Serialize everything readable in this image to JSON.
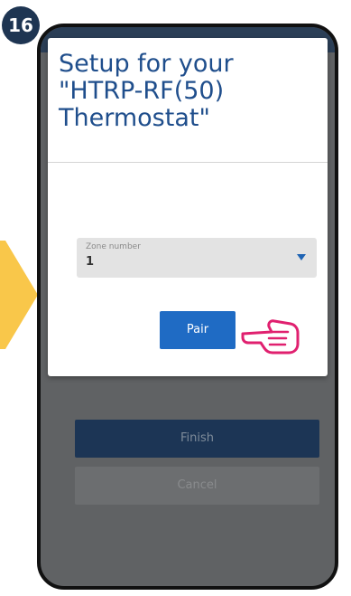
{
  "step": {
    "number": "16"
  },
  "dialog": {
    "title": "Setup for your\n\"HTRP-RF(50)\nThermostat\"",
    "zone_select": {
      "label": "Zone number",
      "value": "1"
    },
    "pair_label": "Pair"
  },
  "background": {
    "finish_label": "Finish",
    "cancel_label": "Cancel"
  },
  "icons": {
    "hand": "pointing-hand-icon",
    "arrow": "side-arrow-icon",
    "dropdown": "chevron-down-icon"
  },
  "colors": {
    "accent": "#1f6bc4",
    "title": "#1f4e8c",
    "badge": "#1e3552",
    "hand": "#e0206f",
    "arrow": "#f9c74a"
  }
}
